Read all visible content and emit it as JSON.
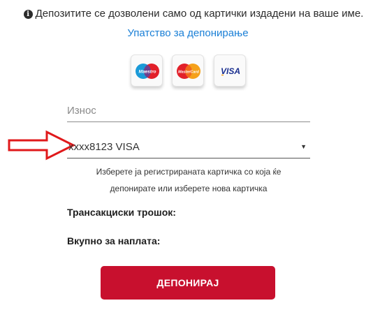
{
  "notice": {
    "icon": "info-circle-icon",
    "text": "Депозитите се дозволени само од картички издадени на ваше име."
  },
  "guide_link": "Упатство за депонирање",
  "cards": [
    {
      "name": "Maestro",
      "icon": "maestro-card-icon"
    },
    {
      "name": "MasterCard",
      "icon": "mastercard-card-icon"
    },
    {
      "name": "VISA",
      "icon": "visa-card-icon"
    }
  ],
  "amount_field": {
    "placeholder": "Износ",
    "value": ""
  },
  "card_select": {
    "selected": "xxxx8123 VISA"
  },
  "hint": "Изберете ја регистрираната картичка со која ќе депонирате или изберете нова картичка",
  "fee_label": "Трансакциски трошок:",
  "total_label": "Вкупно за наплата:",
  "deposit_button": "ДЕПОНИРАЈ",
  "colors": {
    "accent": "#c8102e",
    "link": "#1a7fd6",
    "annotation_arrow": "#e0191b"
  }
}
